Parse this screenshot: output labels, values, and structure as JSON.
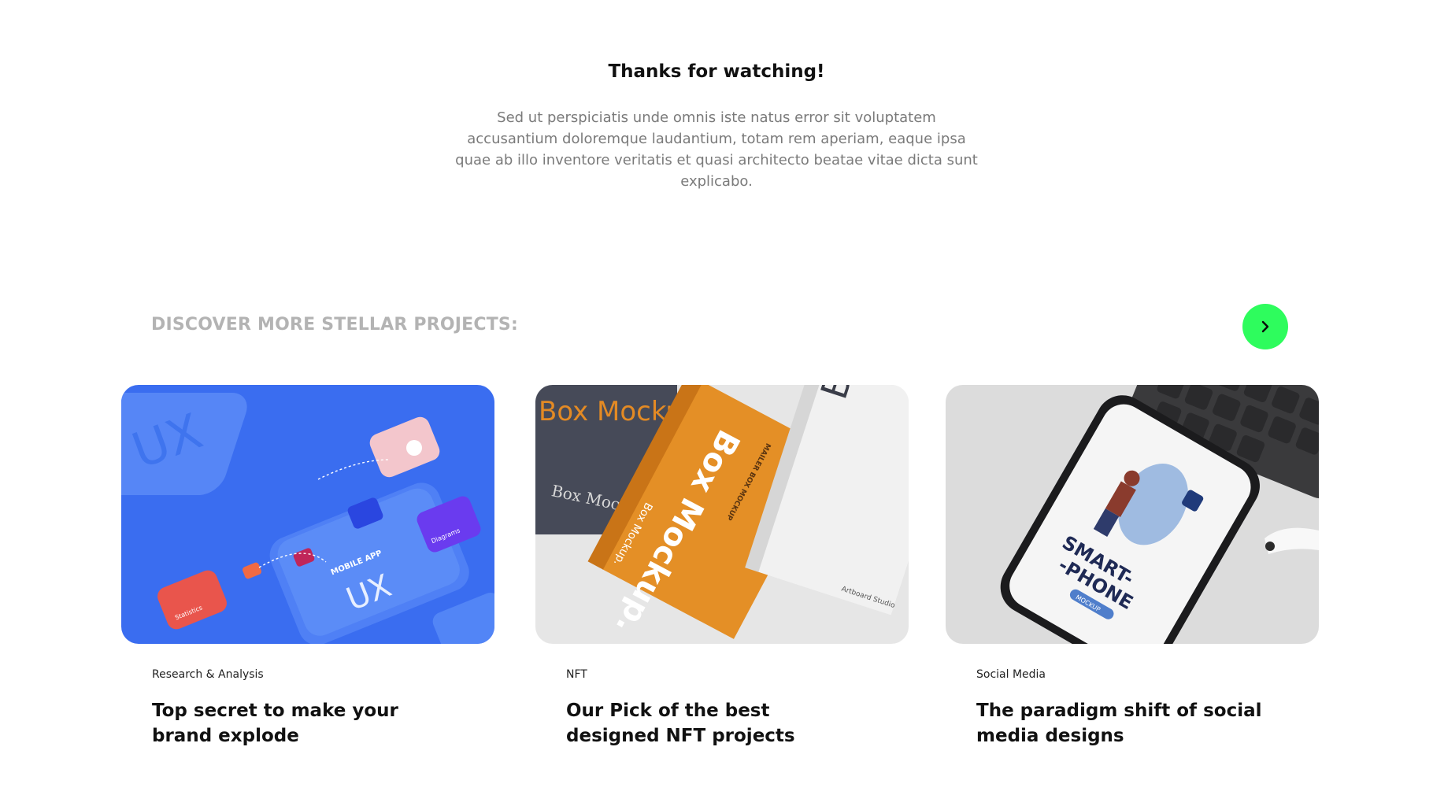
{
  "header": {
    "title": "Thanks for watching!",
    "description": "Sed ut perspiciatis unde omnis iste natus error sit voluptatem accusantium doloremque laudantium, totam rem aperiam, eaque ipsa quae ab illo inventore veritatis et quasi architecto beatae vitae dicta sunt explicabo."
  },
  "discover": {
    "heading": "DISCOVER MORE STELLAR PROJECTS:",
    "next_icon": "chevron-right-icon",
    "accent_color": "#2efc5d"
  },
  "projects": [
    {
      "category": "Research & Analysis",
      "title": "Top secret to make your brand explode",
      "image": {
        "big_text": "UX",
        "app_label": "MOBILE APP",
        "card_label": "Statistics",
        "card2_label": "Diagrams",
        "background": "#3a6df0"
      }
    },
    {
      "category": "NFT",
      "title": "Our Pick of the best designed NFT projects",
      "image": {
        "box_text": "Box Mockup.",
        "box_text_split": "Box Mock",
        "box_small": "MAILER BOX MOCKUP",
        "studio": "Artboard Studio",
        "background": "#e6e6e6"
      }
    },
    {
      "category": "Social Media",
      "title": "The paradigm shift of social media designs",
      "image": {
        "phone_text_1": "SMART-",
        "phone_text_2": "-PHONE",
        "phone_badge": "MOCKUP",
        "background": "#dcdcdc"
      }
    }
  ]
}
